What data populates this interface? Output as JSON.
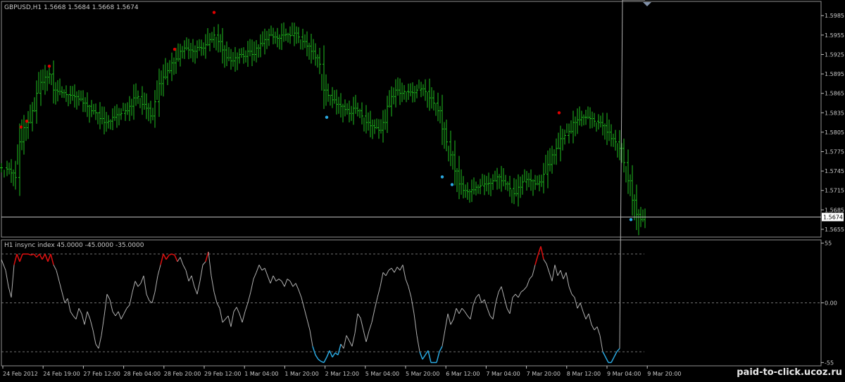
{
  "watermark": "paid-to-click.ucoz.ru",
  "colors": {
    "background": "#000000",
    "bar": "#1fbf1f",
    "axis": "#c0c0c0",
    "text": "#c8c8c8",
    "high_dot": "#e00000",
    "low_dot": "#2aa8e0",
    "indicator": "#b0b0b0",
    "indicator_high": "#e01010",
    "indicator_low": "#2aa8e0",
    "level": "#707070"
  },
  "chart_data": [
    {
      "type": "line",
      "title": "GBPUSD,H1  1.5668 1.5684 1.5668 1.5674",
      "series_style": "ohlc-bars",
      "ylim": [
        1.5643,
        1.6007
      ],
      "y_ticks": [
        1.5985,
        1.5955,
        1.5925,
        1.5895,
        1.5865,
        1.5835,
        1.5805,
        1.5775,
        1.5745,
        1.5715,
        1.5685,
        1.5655
      ],
      "y_tick_labels": [
        "1.5985",
        "1.5955",
        "1.5925",
        "1.5895",
        "1.5865",
        "1.5835",
        "1.5805",
        "1.5775",
        "1.5745",
        "1.5715",
        "1.5685",
        "1.5655"
      ],
      "current_price": 1.5674,
      "current_price_label": "1.5674",
      "x": [
        0,
        8,
        14,
        20,
        26,
        32,
        38,
        44,
        50,
        56,
        62,
        68,
        74,
        80,
        86,
        92,
        98,
        104,
        110,
        116,
        122,
        128,
        134,
        140,
        146,
        152,
        158,
        164,
        170,
        176,
        182,
        188,
        194,
        200,
        206,
        212,
        218,
        224,
        230,
        236,
        242,
        248,
        254,
        260,
        266,
        272,
        278,
        284,
        290,
        296,
        302,
        308,
        314,
        320,
        326,
        332,
        338,
        344,
        350,
        356,
        362,
        368,
        374,
        380,
        386,
        392,
        398,
        404,
        410,
        416,
        422,
        428,
        434,
        440,
        446,
        452,
        458,
        464,
        470,
        476,
        482,
        488,
        494,
        500,
        506,
        512,
        518,
        524,
        530,
        536,
        542,
        548,
        554,
        560,
        566,
        572,
        578,
        584,
        590,
        596,
        602,
        608,
        614,
        620,
        626,
        632,
        638,
        644,
        650,
        656,
        662,
        668,
        674,
        680,
        686,
        692,
        698,
        704,
        710,
        716,
        722,
        728,
        734,
        740,
        746,
        752,
        758,
        764,
        770,
        776,
        782,
        788,
        794,
        800,
        806,
        812,
        818,
        824,
        830,
        836,
        842,
        848,
        854,
        860,
        866,
        872,
        878,
        884,
        890,
        896,
        902,
        908,
        914
      ],
      "y": [
        1.575,
        1.5748,
        1.5742,
        1.5735,
        1.579,
        1.5812,
        1.582,
        1.5838,
        1.5865,
        1.5882,
        1.589,
        1.5895,
        1.587,
        1.5868,
        1.5866,
        1.5863,
        1.5862,
        1.586,
        1.5856,
        1.585,
        1.5845,
        1.5838,
        1.5835,
        1.5826,
        1.582,
        1.5822,
        1.5828,
        1.5832,
        1.5834,
        1.5838,
        1.5845,
        1.5858,
        1.586,
        1.5848,
        1.5842,
        1.583,
        1.5852,
        1.588,
        1.589,
        1.59,
        1.5912,
        1.5918,
        1.593,
        1.5935,
        1.5932,
        1.593,
        1.5936,
        1.5935,
        1.594,
        1.5948,
        1.5955,
        1.5945,
        1.5932,
        1.592,
        1.5915,
        1.592,
        1.5925,
        1.5922,
        1.593,
        1.5925,
        1.5935,
        1.5942,
        1.5948,
        1.5955,
        1.5952,
        1.595,
        1.5955,
        1.5956,
        1.5954,
        1.5958,
        1.5952,
        1.5945,
        1.5938,
        1.593,
        1.592,
        1.591,
        1.587,
        1.5862,
        1.5855,
        1.5848,
        1.5845,
        1.584,
        1.5834,
        1.5842,
        1.5838,
        1.583,
        1.582,
        1.5815,
        1.5812,
        1.5808,
        1.582,
        1.5845,
        1.586,
        1.587,
        1.5865,
        1.5868,
        1.5867,
        1.5866,
        1.587,
        1.5872,
        1.5868,
        1.5858,
        1.585,
        1.5838,
        1.581,
        1.579,
        1.577,
        1.5745,
        1.5725,
        1.5715,
        1.5713,
        1.5716,
        1.572,
        1.5722,
        1.5725,
        1.5726,
        1.573,
        1.5736,
        1.573,
        1.5725,
        1.5718,
        1.571,
        1.572,
        1.5728,
        1.5732,
        1.573,
        1.5725,
        1.5728,
        1.574,
        1.5755,
        1.577,
        1.578,
        1.5795,
        1.58,
        1.5806,
        1.582,
        1.5824,
        1.5828,
        1.5828,
        1.5826,
        1.5822,
        1.582,
        1.5815,
        1.5805,
        1.5795,
        1.579,
        1.578,
        1.5758,
        1.573,
        1.57,
        1.5678,
        1.567,
        1.5674
      ],
      "high_markers": [
        [
          28,
          1.5813
        ],
        [
          36,
          1.5822
        ],
        [
          68,
          1.5907
        ],
        [
          246,
          1.5933
        ],
        [
          302,
          1.599
        ],
        [
          792,
          1.5835
        ]
      ],
      "low_markers": [
        [
          462,
          1.5828
        ],
        [
          626,
          1.5736
        ],
        [
          640,
          1.5724
        ],
        [
          894,
          1.567
        ]
      ]
    },
    {
      "type": "line",
      "title": "H1 insync index 45.0000 -45.0000 -35.0000",
      "ylim": [
        -58,
        58
      ],
      "y_ticks": [
        55,
        0,
        -55
      ],
      "y_tick_labels": [
        "55",
        "0.00",
        "-55"
      ],
      "levels": [
        45,
        0,
        -45
      ],
      "categories": [
        "24 Feb 2012",
        "24 Feb 19:00",
        "27 Feb 12:00",
        "28 Feb 04:00",
        "28 Feb 20:00",
        "29 Feb 12:00",
        "1 Mar 04:00",
        "1 Mar 20:00",
        "2 Mar 12:00",
        "5 Mar 04:00",
        "5 Mar 20:00",
        "6 Mar 12:00",
        "7 Mar 04:00",
        "7 Mar 20:00",
        "8 Mar 12:00",
        "9 Mar 04:00",
        "9 Mar 20:00"
      ],
      "x": [
        0,
        6,
        10,
        14,
        18,
        22,
        26,
        30,
        34,
        38,
        42,
        46,
        50,
        54,
        58,
        62,
        66,
        70,
        74,
        78,
        82,
        86,
        90,
        94,
        98,
        102,
        106,
        110,
        114,
        118,
        122,
        126,
        130,
        134,
        138,
        142,
        146,
        150,
        154,
        158,
        162,
        166,
        170,
        174,
        178,
        182,
        186,
        190,
        194,
        198,
        202,
        206,
        210,
        214,
        218,
        222,
        226,
        230,
        234,
        238,
        242,
        246,
        250,
        254,
        258,
        262,
        266,
        270,
        274,
        278,
        282,
        286,
        290,
        294,
        298,
        302,
        306,
        310,
        314,
        318,
        322,
        326,
        330,
        334,
        338,
        342,
        346,
        350,
        354,
        358,
        362,
        366,
        370,
        374,
        378,
        382,
        386,
        390,
        394,
        398,
        402,
        406,
        410,
        414,
        418,
        422,
        426,
        430,
        434,
        438,
        442,
        446,
        450,
        454,
        458,
        462,
        466,
        470,
        474,
        478,
        482,
        486,
        490,
        494,
        498,
        502,
        506,
        510,
        514,
        518,
        522,
        526,
        530,
        534,
        538,
        542,
        546,
        550,
        554,
        558,
        562,
        566,
        570,
        574,
        578,
        582,
        586,
        590,
        594,
        598,
        602,
        606,
        610,
        614,
        618,
        622,
        626,
        630,
        634,
        638,
        642,
        646,
        650,
        654,
        658,
        662,
        666,
        670,
        674,
        678,
        682,
        686,
        690,
        694,
        698,
        702,
        706,
        710,
        714,
        718,
        722,
        726,
        730,
        734,
        738,
        742,
        746,
        750,
        754,
        758,
        762,
        766,
        770,
        774,
        778,
        782,
        786,
        790,
        794,
        798,
        802,
        806,
        810,
        814,
        818,
        822,
        826,
        830,
        834,
        838,
        842,
        846,
        850,
        854,
        858,
        862,
        866,
        870,
        874,
        878,
        882,
        886,
        890,
        894,
        898,
        902,
        906,
        910,
        914
      ],
      "y": [
        40,
        30,
        15,
        5,
        35,
        45,
        38,
        45,
        45,
        45,
        44,
        45,
        42,
        45,
        40,
        45,
        38,
        45,
        35,
        30,
        20,
        10,
        0,
        4,
        -8,
        -12,
        -15,
        -5,
        -10,
        -20,
        -8,
        -15,
        -25,
        -38,
        -42,
        -30,
        -12,
        8,
        3,
        -8,
        -12,
        -8,
        -15,
        -10,
        -5,
        -2,
        10,
        20,
        15,
        18,
        25,
        8,
        2,
        0,
        10,
        25,
        35,
        45,
        40,
        44,
        45,
        44,
        38,
        42,
        35,
        30,
        20,
        25,
        15,
        8,
        20,
        35,
        38,
        47,
        25,
        10,
        0,
        -5,
        -18,
        -15,
        -12,
        -22,
        -8,
        -4,
        -10,
        -18,
        -8,
        0,
        10,
        22,
        28,
        35,
        30,
        32,
        25,
        18,
        25,
        20,
        22,
        20,
        15,
        22,
        20,
        15,
        18,
        12,
        5,
        -5,
        -15,
        -25,
        -40,
        -48,
        -52,
        -54,
        -55,
        -50,
        -44,
        -50,
        -46,
        -48,
        -38,
        -42,
        -30,
        -35,
        -40,
        -28,
        -10,
        -14,
        -25,
        -36,
        -26,
        -18,
        -6,
        5,
        15,
        28,
        25,
        30,
        32,
        28,
        33,
        30,
        35,
        22,
        15,
        5,
        -10,
        -30,
        -45,
        -52,
        -48,
        -44,
        -55,
        -55,
        -55,
        -45,
        -40,
        -25,
        -10,
        -20,
        -15,
        -5,
        -10,
        -5,
        -8,
        -12,
        -15,
        -2,
        5,
        8,
        0,
        3,
        -5,
        -12,
        -15,
        0,
        10,
        15,
        5,
        -5,
        -10,
        5,
        8,
        5,
        10,
        12,
        15,
        22,
        25,
        35,
        44,
        52,
        40,
        36,
        28,
        20,
        35,
        25,
        30,
        22,
        28,
        15,
        8,
        5,
        -5,
        0,
        -8,
        -15,
        -10,
        -20,
        -25,
        -22,
        -30,
        -45,
        -50,
        -55,
        -55,
        -50,
        -45,
        -42
      ]
    }
  ]
}
